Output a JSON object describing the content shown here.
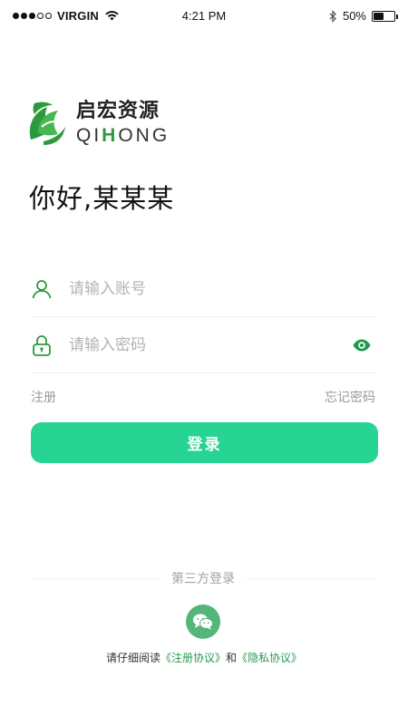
{
  "status_bar": {
    "carrier": "VIRGIN",
    "time": "4:21 PM",
    "battery": "50%",
    "battery_level": 0.5
  },
  "logo": {
    "name_cn": "启宏资源",
    "name_en_left": "QI",
    "name_en_accent": "H",
    "name_en_right": "ONG"
  },
  "greeting": "你好,某某某",
  "form": {
    "account_placeholder": "请输入账号",
    "password_placeholder": "请输入密码"
  },
  "links": {
    "register": "注册",
    "forgot_password": "忘记密码"
  },
  "login_button": "登录",
  "third_party": {
    "label": "第三方登录"
  },
  "agreement": {
    "prefix": "请仔细阅读",
    "terms": "《注册协议》",
    "conjunction": "和",
    "privacy": "《隐私协议》"
  },
  "colors": {
    "primary": "#27d493",
    "icon_green": "#2c9a3c",
    "wechat_green": "#54b678"
  }
}
